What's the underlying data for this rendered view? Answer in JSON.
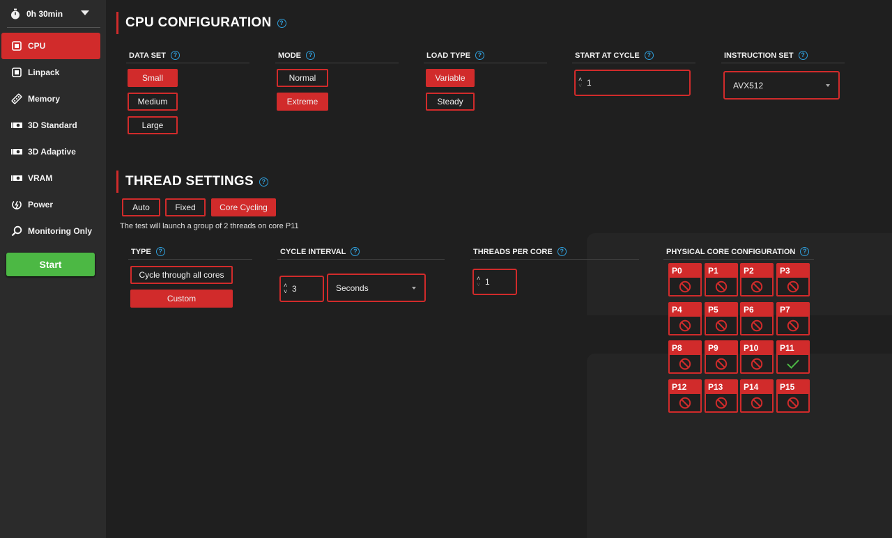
{
  "timer": {
    "label": "0h 30min"
  },
  "sidebar": {
    "items": [
      {
        "label": "CPU",
        "icon": "cpu-icon",
        "active": true
      },
      {
        "label": "Linpack",
        "icon": "linpack-icon"
      },
      {
        "label": "Memory",
        "icon": "memory-icon"
      },
      {
        "label": "3D Standard",
        "icon": "gpu-icon"
      },
      {
        "label": "3D Adaptive",
        "icon": "gpu-icon"
      },
      {
        "label": "VRAM",
        "icon": "gpu-icon"
      },
      {
        "label": "Power",
        "icon": "power-icon"
      },
      {
        "label": "Monitoring Only",
        "icon": "search-icon"
      }
    ],
    "start_label": "Start"
  },
  "cpu_config": {
    "title": "CPU CONFIGURATION",
    "data_set": {
      "label": "DATA SET",
      "options": [
        "Small",
        "Medium",
        "Large"
      ],
      "selected": "Small"
    },
    "mode": {
      "label": "MODE",
      "options": [
        "Normal",
        "Extreme"
      ],
      "selected": "Extreme"
    },
    "load_type": {
      "label": "LOAD TYPE",
      "options": [
        "Variable",
        "Steady"
      ],
      "selected": "Variable"
    },
    "start_at_cycle": {
      "label": "START AT CYCLE",
      "value": "1"
    },
    "instruction_set": {
      "label": "INSTRUCTION SET",
      "value": "AVX512"
    }
  },
  "thread_settings": {
    "title": "THREAD SETTINGS",
    "modes": [
      "Auto",
      "Fixed",
      "Core Cycling"
    ],
    "selected_mode": "Core Cycling",
    "note": "The test will launch a group of 2 threads on core P11",
    "type": {
      "label": "TYPE",
      "options": [
        "Cycle through all cores",
        "Custom"
      ],
      "selected": "Custom"
    },
    "cycle_interval": {
      "label": "CYCLE INTERVAL",
      "value": "3",
      "unit": "Seconds"
    },
    "threads_per_core": {
      "label": "THREADS PER CORE",
      "value": "1"
    },
    "physical_cores": {
      "label": "PHYSICAL CORE CONFIGURATION",
      "cores": [
        {
          "name": "P0",
          "enabled": false
        },
        {
          "name": "P1",
          "enabled": false
        },
        {
          "name": "P2",
          "enabled": false
        },
        {
          "name": "P3",
          "enabled": false
        },
        {
          "name": "P4",
          "enabled": false
        },
        {
          "name": "P5",
          "enabled": false
        },
        {
          "name": "P6",
          "enabled": false
        },
        {
          "name": "P7",
          "enabled": false
        },
        {
          "name": "P8",
          "enabled": false
        },
        {
          "name": "P9",
          "enabled": false
        },
        {
          "name": "P10",
          "enabled": false
        },
        {
          "name": "P11",
          "enabled": true
        },
        {
          "name": "P12",
          "enabled": false
        },
        {
          "name": "P13",
          "enabled": false
        },
        {
          "name": "P14",
          "enabled": false
        },
        {
          "name": "P15",
          "enabled": false
        }
      ]
    }
  },
  "colors": {
    "accent": "#d12b2b",
    "start": "#4cb844",
    "help": "#2f9fdc",
    "check": "#4cb844"
  }
}
